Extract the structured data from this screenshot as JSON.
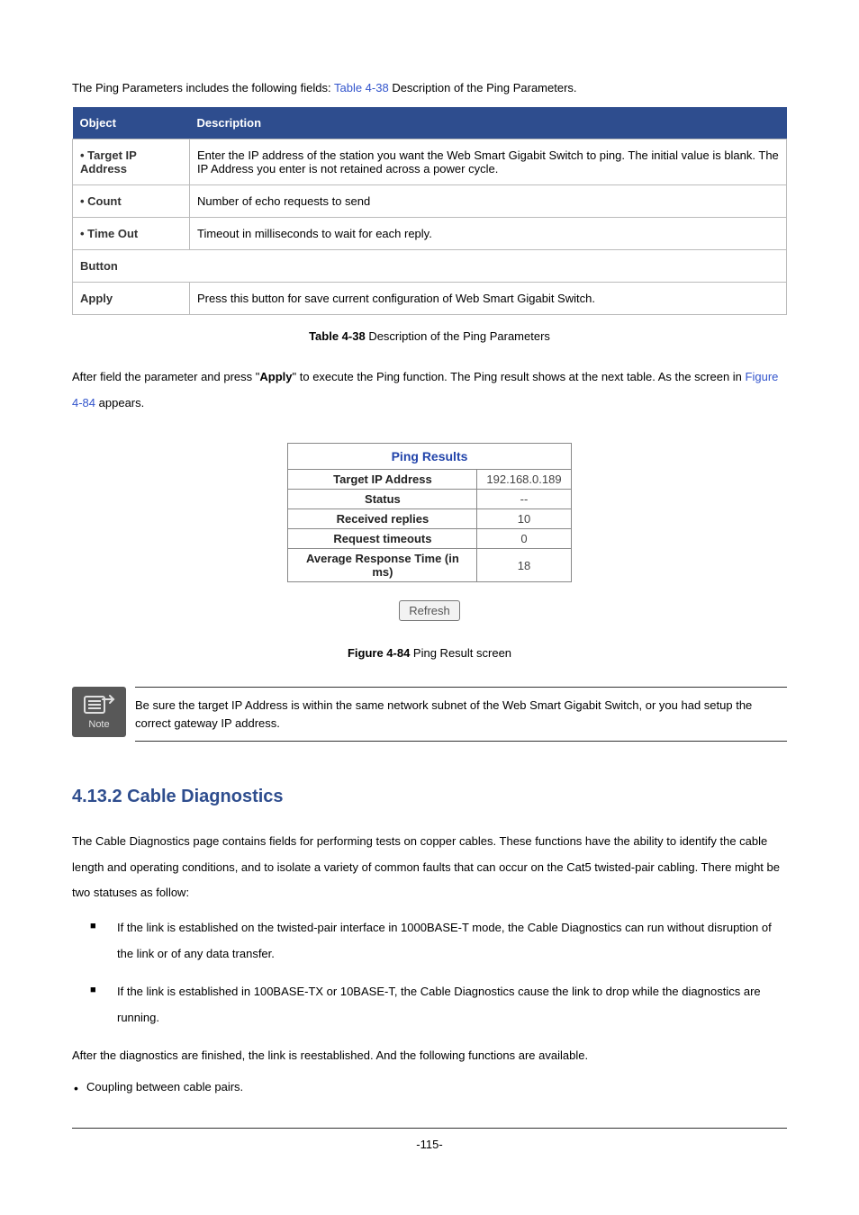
{
  "intro": {
    "prefix": "The Ping Parameters includes the following fields:",
    "xref": "Table 4-38",
    "suffix": " Description of the Ping Parameters."
  },
  "table": {
    "headers": {
      "object": "Object",
      "description": "Description"
    },
    "rows": [
      {
        "object": "• Target IP Address",
        "description": "Enter the IP address of the station you want the Web Smart Gigabit Switch to ping. The initial value is blank. The IP Address you enter is not retained across a power cycle."
      },
      {
        "object": "• Count",
        "description": "Number of echo requests to send"
      },
      {
        "object": "• Time Out",
        "description": "Timeout in milliseconds to wait for each reply."
      }
    ],
    "button_row_label": "Button",
    "button_row": {
      "object": "Apply",
      "description": "Press this button for save current configuration of Web Smart Gigabit Switch."
    }
  },
  "table_caption": {
    "xref": "Table 4-38",
    "text": " Description of the Ping Parameters"
  },
  "para_after": {
    "part1": "After field the parameter and press \"",
    "bold": "Apply",
    "part2": "\" to execute the Ping function. The Ping result shows at the next table. As the screen in ",
    "xref": "Figure 4-84",
    "part3": " appears."
  },
  "ping_results": {
    "title": "Ping Results",
    "rows": [
      {
        "label": "Target IP Address",
        "value": "192.168.0.189"
      },
      {
        "label": "Status",
        "value": "--"
      },
      {
        "label": "Received replies",
        "value": "10"
      },
      {
        "label": "Request timeouts",
        "value": "0"
      },
      {
        "label": "Average Response Time (in ms)",
        "value": "18"
      }
    ],
    "refresh": "Refresh"
  },
  "figure_caption": {
    "xref": "Figure 4-84",
    "text": " Ping Result screen"
  },
  "note": {
    "label": "Note",
    "text": "Be sure the target IP Address is within the same network subnet of the Web Smart Gigabit Switch, or you had setup the correct gateway IP address."
  },
  "section": {
    "title": "4.13.2 Cable Diagnostics",
    "para1": "The Cable Diagnostics page contains fields for performing tests on copper cables. These functions have the ability to identify the cable length and operating conditions, and to isolate a variety of common faults that can occur on the Cat5 twisted-pair cabling. There might be two statuses as follow:",
    "list": [
      "If the link is established on the twisted-pair interface in 1000BASE-T mode, the Cable Diagnostics can run without disruption of the link or of any data transfer.",
      "If the link is established in 100BASE-TX or 10BASE-T, the Cable Diagnostics cause the link to drop while the diagnostics are running."
    ],
    "para2": "After the diagnostics are finished, the link is reestablished. And the following functions are available.",
    "bullets": [
      "Coupling between cable pairs."
    ]
  },
  "footer": "-115-"
}
